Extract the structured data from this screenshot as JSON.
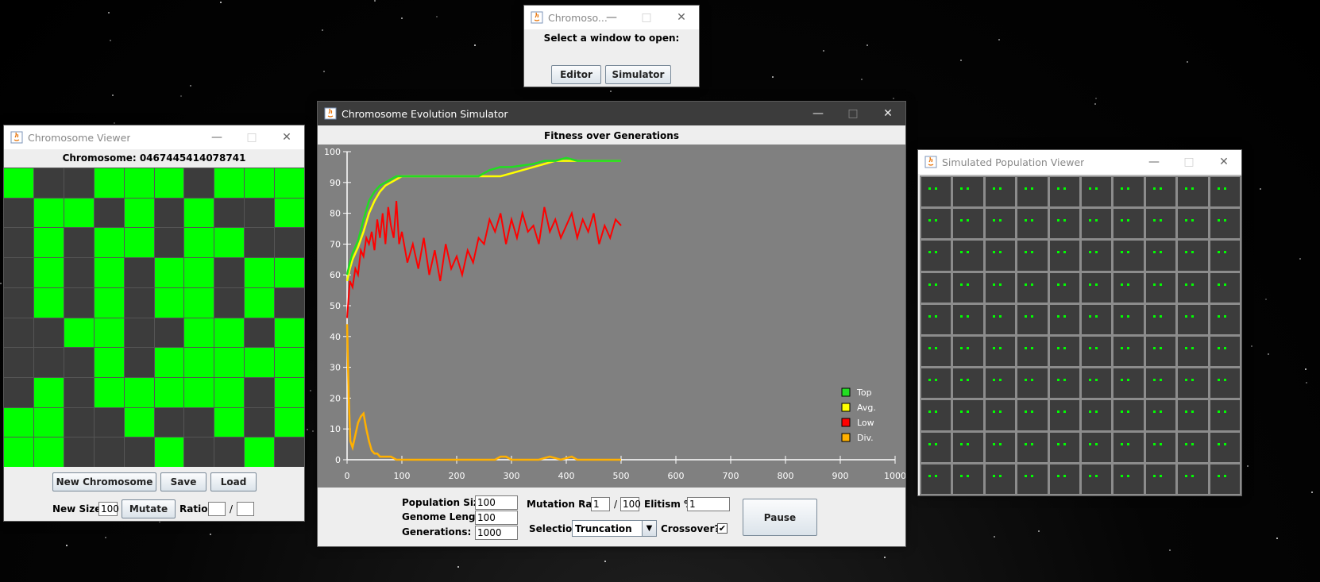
{
  "launcher": {
    "title": "Chromoso...",
    "prompt": "Select a window to open:",
    "editor_label": "Editor",
    "simulator_label": "Simulator"
  },
  "viewer": {
    "title": "Chromosome Viewer",
    "chromosome_label": "Chromosome: 0467445414078741",
    "grid": [
      [
        1,
        0,
        0,
        1,
        1,
        1,
        0,
        1,
        1,
        1
      ],
      [
        0,
        1,
        1,
        0,
        1,
        0,
        1,
        0,
        0,
        1
      ],
      [
        0,
        1,
        0,
        1,
        1,
        0,
        1,
        1,
        0,
        0
      ],
      [
        0,
        1,
        0,
        1,
        0,
        1,
        1,
        0,
        1,
        1
      ],
      [
        0,
        1,
        0,
        1,
        0,
        1,
        1,
        0,
        1,
        0
      ],
      [
        0,
        0,
        1,
        1,
        0,
        0,
        1,
        1,
        0,
        1
      ],
      [
        0,
        0,
        0,
        1,
        0,
        1,
        1,
        1,
        1,
        1
      ],
      [
        0,
        1,
        0,
        1,
        1,
        1,
        1,
        1,
        0,
        1
      ],
      [
        1,
        1,
        0,
        0,
        1,
        0,
        0,
        1,
        0,
        1
      ],
      [
        1,
        1,
        0,
        0,
        0,
        1,
        0,
        0,
        1,
        0
      ]
    ],
    "new_chromosome_label": "New Chromosome",
    "save_label": "Save",
    "load_label": "Load",
    "new_size_label": "New Size:",
    "new_size_value": "100",
    "mutate_label": "Mutate",
    "ratio_label": "Ratio:",
    "ratio_sep": "/",
    "ratio_num": "",
    "ratio_den": ""
  },
  "simulator": {
    "title": "Chromosome Evolution Simulator",
    "population_size_label": "Population Size:",
    "population_size_value": "100",
    "genome_length_label": "Genome Length:",
    "genome_length_value": "100",
    "generations_label": "Generations:",
    "generations_value": "1000",
    "mutation_rate_label": "Mutation Rate:",
    "mutation_rate_num": "1",
    "mutation_rate_sep": "/",
    "mutation_rate_den": "100",
    "elitism_label": "Elitism %:",
    "elitism_value": "1",
    "selection_label": "Selection",
    "selection_value": "Truncation",
    "crossover_label": "Crossover?",
    "crossover_checked": true,
    "pause_label": "Pause"
  },
  "population": {
    "title": "Simulated Population Viewer",
    "rows": 10,
    "cols": 10
  },
  "chart_data": {
    "type": "line",
    "title": "Fitness over Generations",
    "xlim": [
      0,
      1000
    ],
    "ylim": [
      0,
      100
    ],
    "xticks": [
      0,
      100,
      200,
      300,
      400,
      500,
      600,
      700,
      800,
      900,
      1000
    ],
    "yticks": [
      0,
      10,
      20,
      30,
      40,
      50,
      60,
      70,
      80,
      90,
      100
    ],
    "legend_position": "bottom-right",
    "series": [
      {
        "name": "Top",
        "color": "#22dd22",
        "x": [
          0,
          5,
          10,
          20,
          30,
          40,
          50,
          60,
          70,
          80,
          90,
          100,
          150,
          200,
          240,
          260,
          280,
          300,
          340,
          360,
          380,
          400,
          420,
          450,
          500
        ],
        "y": [
          60,
          64,
          67,
          71,
          78,
          84,
          87,
          89,
          90,
          91,
          92,
          92,
          92,
          92,
          92,
          94,
          95,
          95,
          96,
          97,
          97,
          98,
          97,
          97,
          97
        ]
      },
      {
        "name": "Avg.",
        "color": "#ffff00",
        "x": [
          0,
          5,
          10,
          20,
          30,
          40,
          50,
          60,
          70,
          80,
          90,
          100,
          150,
          200,
          250,
          280,
          300,
          340,
          360,
          380,
          400,
          450,
          500
        ],
        "y": [
          58,
          62,
          65,
          69,
          74,
          80,
          84,
          87,
          89,
          90,
          91,
          92,
          92,
          92,
          92,
          92,
          93,
          95,
          96,
          97,
          97,
          97,
          97
        ]
      },
      {
        "name": "Low",
        "color": "#ff0000",
        "x": [
          0,
          5,
          10,
          15,
          20,
          25,
          30,
          35,
          40,
          45,
          50,
          55,
          60,
          65,
          70,
          75,
          80,
          85,
          90,
          95,
          100,
          110,
          120,
          130,
          140,
          150,
          160,
          170,
          180,
          190,
          200,
          210,
          220,
          230,
          240,
          250,
          260,
          270,
          280,
          290,
          300,
          310,
          320,
          330,
          340,
          350,
          360,
          370,
          380,
          390,
          400,
          410,
          420,
          430,
          440,
          450,
          460,
          470,
          480,
          490,
          500
        ],
        "y": [
          46,
          58,
          56,
          62,
          60,
          68,
          66,
          72,
          70,
          74,
          68,
          78,
          72,
          80,
          70,
          82,
          76,
          72,
          84,
          70,
          74,
          64,
          70,
          62,
          72,
          60,
          68,
          58,
          70,
          62,
          66,
          60,
          68,
          64,
          72,
          70,
          78,
          74,
          80,
          70,
          78,
          72,
          80,
          74,
          76,
          70,
          82,
          74,
          78,
          72,
          76,
          80,
          72,
          78,
          74,
          80,
          70,
          76,
          72,
          78,
          76
        ]
      },
      {
        "name": "Div.",
        "color": "#ffb000",
        "x": [
          0,
          3,
          6,
          10,
          15,
          20,
          25,
          30,
          35,
          40,
          45,
          50,
          55,
          60,
          65,
          70,
          80,
          90,
          100,
          150,
          200,
          250,
          270,
          280,
          290,
          300,
          350,
          370,
          390,
          410,
          420,
          500
        ],
        "y": [
          44,
          20,
          6,
          4,
          8,
          12,
          14,
          15,
          10,
          6,
          3,
          2,
          2,
          1,
          1,
          1,
          1,
          0,
          0,
          0,
          0,
          0,
          0,
          1,
          1,
          0,
          0,
          1,
          0,
          1,
          0,
          0
        ]
      }
    ]
  }
}
